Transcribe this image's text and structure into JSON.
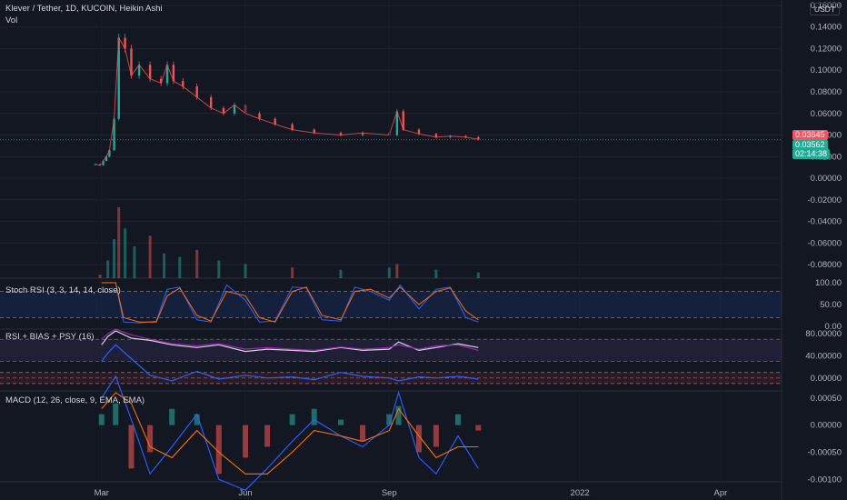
{
  "header": {
    "symbol_title": "Klever / Tether, 1D, KUCOIN, Heikin Ashi",
    "volume_label": "Vol",
    "currency": "USDT"
  },
  "price_tags": {
    "last_price": "0.03645",
    "close_price": "0.03562",
    "countdown": "02:14:38",
    "last_color": "#f7525f",
    "close_color": "#22ab94"
  },
  "colors": {
    "background": "#131722",
    "up": "#26a69a",
    "down": "#ef5350",
    "stoch_k": "#2962ff",
    "stoch_d": "#ff6d00",
    "rsi": "#d1d4dc",
    "bias": "#9c27b0",
    "psy": "#2962ff",
    "macd": "#2962ff",
    "signal": "#ff6d00"
  },
  "chart_data": [
    {
      "type": "line",
      "pane": "price",
      "title": "Klever / Tether, 1D, KUCOIN, Heikin Ashi",
      "x": [
        "2021-02-25",
        "2021-02-28",
        "2021-03-02",
        "2021-03-04",
        "2021-03-06",
        "2021-03-09",
        "2021-03-12",
        "2021-03-16",
        "2021-03-20",
        "2021-03-25",
        "2021-04-01",
        "2021-04-08",
        "2021-04-12",
        "2021-04-16",
        "2021-04-22",
        "2021-05-01",
        "2021-05-10",
        "2021-05-18",
        "2021-05-25",
        "2021-06-01",
        "2021-06-10",
        "2021-06-20",
        "2021-07-01",
        "2021-07-15",
        "2021-08-01",
        "2021-08-15",
        "2021-09-01",
        "2021-09-06",
        "2021-09-10",
        "2021-09-20",
        "2021-10-01",
        "2021-10-10",
        "2021-10-20",
        "2021-10-28"
      ],
      "y": [
        0.013,
        0.012,
        0.016,
        0.02,
        0.026,
        0.055,
        0.13,
        0.12,
        0.095,
        0.105,
        0.092,
        0.088,
        0.105,
        0.09,
        0.085,
        0.075,
        0.065,
        0.06,
        0.068,
        0.06,
        0.055,
        0.05,
        0.045,
        0.042,
        0.04,
        0.042,
        0.04,
        0.062,
        0.045,
        0.041,
        0.038,
        0.039,
        0.038,
        0.036
      ],
      "ylim": [
        -0.09,
        0.165
      ],
      "yticks": [
        "0.16000",
        "0.14000",
        "0.12000",
        "0.10000",
        "0.08000",
        "0.06000",
        "0.04000",
        "0.02000",
        "0.00000",
        "-0.02000",
        "-0.04000",
        "-0.06000",
        "-0.08000"
      ],
      "xticks": [
        "Mar",
        "Jun",
        "Sep",
        "2022",
        "Apr"
      ]
    },
    {
      "type": "bar",
      "pane": "volume",
      "name": "Vol",
      "x": [
        "2021-02-28",
        "2021-03-05",
        "2021-03-09",
        "2021-03-12",
        "2021-03-16",
        "2021-03-22",
        "2021-04-01",
        "2021-04-10",
        "2021-04-20",
        "2021-05-01",
        "2021-05-15",
        "2021-06-01",
        "2021-07-01",
        "2021-08-01",
        "2021-09-01",
        "2021-09-06",
        "2021-10-01",
        "2021-10-28"
      ],
      "values": [
        0.05,
        0.25,
        0.55,
        1.0,
        0.7,
        0.45,
        0.6,
        0.35,
        0.3,
        0.4,
        0.25,
        0.2,
        0.15,
        0.12,
        0.15,
        0.2,
        0.12,
        0.08
      ],
      "ylim": [
        0,
        1
      ]
    },
    {
      "type": "line",
      "pane": "stoch_rsi",
      "title": "Stoch RSI (3, 3, 14, 14, close)",
      "x": [
        "2021-03-01",
        "2021-03-10",
        "2021-03-15",
        "2021-03-25",
        "2021-04-05",
        "2021-04-12",
        "2021-04-20",
        "2021-05-01",
        "2021-05-10",
        "2021-05-20",
        "2021-06-01",
        "2021-06-10",
        "2021-06-20",
        "2021-07-01",
        "2021-07-10",
        "2021-07-20",
        "2021-08-01",
        "2021-08-10",
        "2021-08-20",
        "2021-09-01",
        "2021-09-08",
        "2021-09-20",
        "2021-10-01",
        "2021-10-10",
        "2021-10-20",
        "2021-10-28"
      ],
      "series": [
        {
          "values": [
            100,
            100,
            10,
            8,
            12,
            85,
            90,
            15,
            10,
            95,
            60,
            10,
            12,
            90,
            88,
            15,
            12,
            90,
            80,
            60,
            95,
            40,
            85,
            90,
            20,
            10
          ]
        },
        {
          "values": [
            100,
            100,
            20,
            10,
            10,
            70,
            88,
            25,
            12,
            80,
            70,
            20,
            10,
            80,
            90,
            25,
            15,
            80,
            85,
            65,
            90,
            50,
            80,
            88,
            35,
            15
          ]
        }
      ],
      "ylim": [
        0,
        100
      ],
      "yticks": [
        "100.00",
        "50.00",
        "0.00"
      ]
    },
    {
      "type": "line",
      "pane": "rsi_bias_psy",
      "title": "RSI + BIAS + PSY (16)",
      "x": [
        "2021-03-01",
        "2021-03-05",
        "2021-03-10",
        "2021-03-20",
        "2021-04-01",
        "2021-04-15",
        "2021-05-01",
        "2021-05-15",
        "2021-06-01",
        "2021-06-15",
        "2021-07-01",
        "2021-07-15",
        "2021-08-01",
        "2021-08-15",
        "2021-09-01",
        "2021-09-07",
        "2021-09-20",
        "2021-10-01",
        "2021-10-15",
        "2021-10-28"
      ],
      "series": [
        {
          "values": [
            60,
            75,
            85,
            72,
            68,
            60,
            55,
            60,
            48,
            52,
            50,
            48,
            55,
            50,
            52,
            65,
            50,
            55,
            62,
            55
          ]
        },
        {
          "values": [
            70,
            80,
            88,
            78,
            70,
            62,
            58,
            62,
            52,
            55,
            52,
            50,
            56,
            52,
            55,
            60,
            52,
            58,
            60,
            50
          ]
        },
        {
          "values": [
            30,
            45,
            60,
            35,
            5,
            -5,
            12,
            -2,
            5,
            0,
            2,
            -3,
            10,
            3,
            0,
            -5,
            2,
            0,
            3,
            -2
          ]
        }
      ],
      "ylim": [
        -20,
        90
      ],
      "yticks": [
        "80.00000",
        "40.00000",
        "0.00000"
      ]
    },
    {
      "type": "bar",
      "pane": "macd",
      "title": "MACD (12, 26, close, 9, EMA, EMA)",
      "x": [
        "2021-03-01",
        "2021-03-10",
        "2021-03-20",
        "2021-04-01",
        "2021-04-15",
        "2021-05-01",
        "2021-05-15",
        "2021-06-01",
        "2021-06-15",
        "2021-07-01",
        "2021-07-15",
        "2021-08-01",
        "2021-08-15",
        "2021-09-01",
        "2021-09-07",
        "2021-09-20",
        "2021-10-01",
        "2021-10-15",
        "2021-10-28"
      ],
      "values": [
        0.0002,
        0.0004,
        -0.0008,
        -0.0005,
        0.0003,
        0.0002,
        -0.0009,
        -0.0006,
        -0.0004,
        0.0002,
        0.0003,
        0.0001,
        -0.0003,
        0.0002,
        0.00035,
        -0.0005,
        -0.0004,
        0.0002,
        -0.0001
      ],
      "series": [
        {
          "values": [
            0.0005,
            0.0009,
            0.0001,
            -0.0009,
            -0.0004,
            0.0002,
            -0.001,
            -0.0012,
            -0.0008,
            -0.0003,
            0.0001,
            -0.0002,
            -0.0004,
            0.0,
            0.0006,
            -0.0006,
            -0.0009,
            -0.0002,
            -0.0008
          ]
        },
        {
          "values": [
            0.0003,
            0.0006,
            0.0004,
            -0.0004,
            -0.0006,
            -0.0001,
            -0.0005,
            -0.0009,
            -0.0009,
            -0.0005,
            -0.0001,
            -0.0002,
            -0.0003,
            -0.0001,
            0.0003,
            -0.0002,
            -0.0006,
            -0.0004,
            -0.0004
          ]
        }
      ],
      "ylim": [
        -0.00118,
        0.00063
      ],
      "yticks": [
        "0.00050",
        "0.00000",
        "-0.00050",
        "-0.00100"
      ]
    }
  ]
}
